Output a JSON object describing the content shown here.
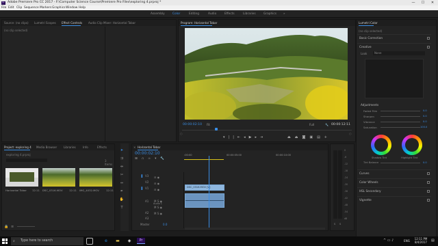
{
  "window": {
    "title": "Adobe Premiere Pro CC 2017 - F:\\Computer Science Course\\Premiere Pro Files\\exploring 4.prproj *",
    "app_icon": "Pr"
  },
  "window_controls": [
    "—",
    "☐",
    "✕"
  ],
  "menu": [
    "File",
    "Edit",
    "Clip",
    "Sequence",
    "Markers",
    "Graphics",
    "Window",
    "Help"
  ],
  "workspaces": {
    "items": [
      "Assembly",
      "Color",
      "Editing",
      "Audio",
      "Effects",
      "Libraries",
      "Graphics"
    ],
    "active": "Color",
    "more": "»"
  },
  "source_panel": {
    "tabs": [
      "Source: (no clips)",
      "Lumetri Scopes",
      "Effect Controls",
      "Audio Clip Mixer: Horizontal Tobar"
    ],
    "active": "Effect Controls",
    "content": "(no clip selected)"
  },
  "program": {
    "title": "Program: Horizontal Tobar",
    "timecode": "00:00:02:10",
    "fit": "Fit",
    "quality": "Full",
    "duration": "00:00:12:11",
    "playhead_fraction": 0.2
  },
  "lumetri": {
    "title": "Lumetri Color",
    "clip": "(no clip selected)",
    "sections": [
      "Basic Correction",
      "Creative",
      "Curves",
      "Color Wheels",
      "HSL Secondary",
      "Vignette"
    ],
    "look_label": "Look",
    "look_value": "None",
    "adjustments": "Adjustments",
    "adj_rows": [
      "Faded Film",
      "Sharpen",
      "Vibrance",
      "Saturation"
    ],
    "adj_values": [
      "0.0",
      "0.0",
      "0.0",
      "100.0"
    ],
    "wheel_labels": [
      "Shadow Tint",
      "Highlight Tint"
    ],
    "tint_balance": "Tint Balance",
    "tint_value": "0.0"
  },
  "project": {
    "tabs": [
      "Project: exploring 4",
      "Media Browser",
      "Libraries",
      "Info",
      "Effects",
      "Markers"
    ],
    "active": "Project: exploring 4",
    "file": "exploring 4.prproj",
    "count": "3 Items",
    "items": [
      {
        "name": "Horizontal Tobar",
        "dur": "12:11"
      },
      {
        "name": "DSC_0316.MOV",
        "dur": "12:11"
      },
      {
        "name": "IMG_4032.MOV",
        "dur": "12:11"
      }
    ]
  },
  "timeline": {
    "tab": "Horizontal Tobar",
    "timecode": "00:00:02:10",
    "ruler": [
      ":00:00",
      "00:00:05:00",
      "00:00:10:00"
    ],
    "video_tracks": [
      "V3",
      "V2",
      "V1"
    ],
    "audio_tracks": [
      "A1",
      "A2",
      "A3"
    ],
    "master": "Master",
    "master_val": "0.0",
    "audio_label": "Audio 1",
    "clip_name": "DSC_0316.MOV [V]",
    "playhead_fraction": 0.17
  },
  "meter": {
    "scale": [
      "0",
      "-6",
      "-12",
      "-18",
      "-24",
      "-30",
      "-36",
      "-42",
      "-48",
      "-54",
      "dB"
    ],
    "solo": [
      "S",
      "S"
    ]
  },
  "taskbar": {
    "search": "Type here to search",
    "time": "12:11 PM",
    "date": "8/4/2017",
    "lang": "ENG"
  }
}
